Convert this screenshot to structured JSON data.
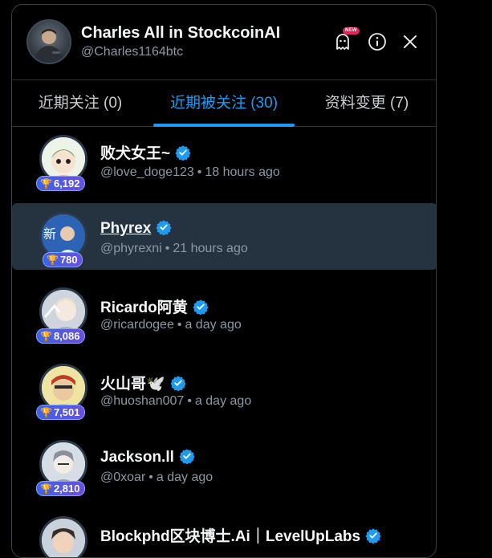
{
  "header": {
    "name": "Charles All in StockcoinAI",
    "handle": "@Charles1164btc",
    "new_badge": "NEW",
    "icons": [
      "ghost-icon",
      "info-icon",
      "close-icon"
    ]
  },
  "tabs": [
    {
      "label": "近期关注 (0)",
      "active": false
    },
    {
      "label": "近期被关注 (30)",
      "active": true
    },
    {
      "label": "资料变更 (7)",
      "active": false
    }
  ],
  "rows": [
    {
      "name": "败犬女王~",
      "handle": "@love_doge123",
      "time": "18 hours ago",
      "score": "6,192",
      "verified": true
    },
    {
      "name": "Phyrex",
      "handle": "@phyrexni",
      "time": "21 hours ago",
      "score": "780",
      "verified": true
    },
    {
      "name": "Ricardo阿黄",
      "handle": "@ricardogee",
      "time": "a day ago",
      "score": "8,086",
      "verified": true
    },
    {
      "name": "火山哥🕊️",
      "handle": "@huoshan007",
      "time": "a day ago",
      "score": "7,501",
      "verified": true
    },
    {
      "name": "Jackson.ll",
      "handle": "@0xoar",
      "time": "a day ago",
      "score": "2,810",
      "verified": true
    },
    {
      "name": "Blockphd区块博士.Ai｜LevelUpLabs",
      "handle": "",
      "time": "",
      "score": "",
      "verified": true
    }
  ],
  "colors": {
    "accent": "#1d9bf0",
    "highlight_row": "#253341",
    "badge_gradient_start": "#3b64e8",
    "badge_gradient_end": "#6b4fe0"
  }
}
